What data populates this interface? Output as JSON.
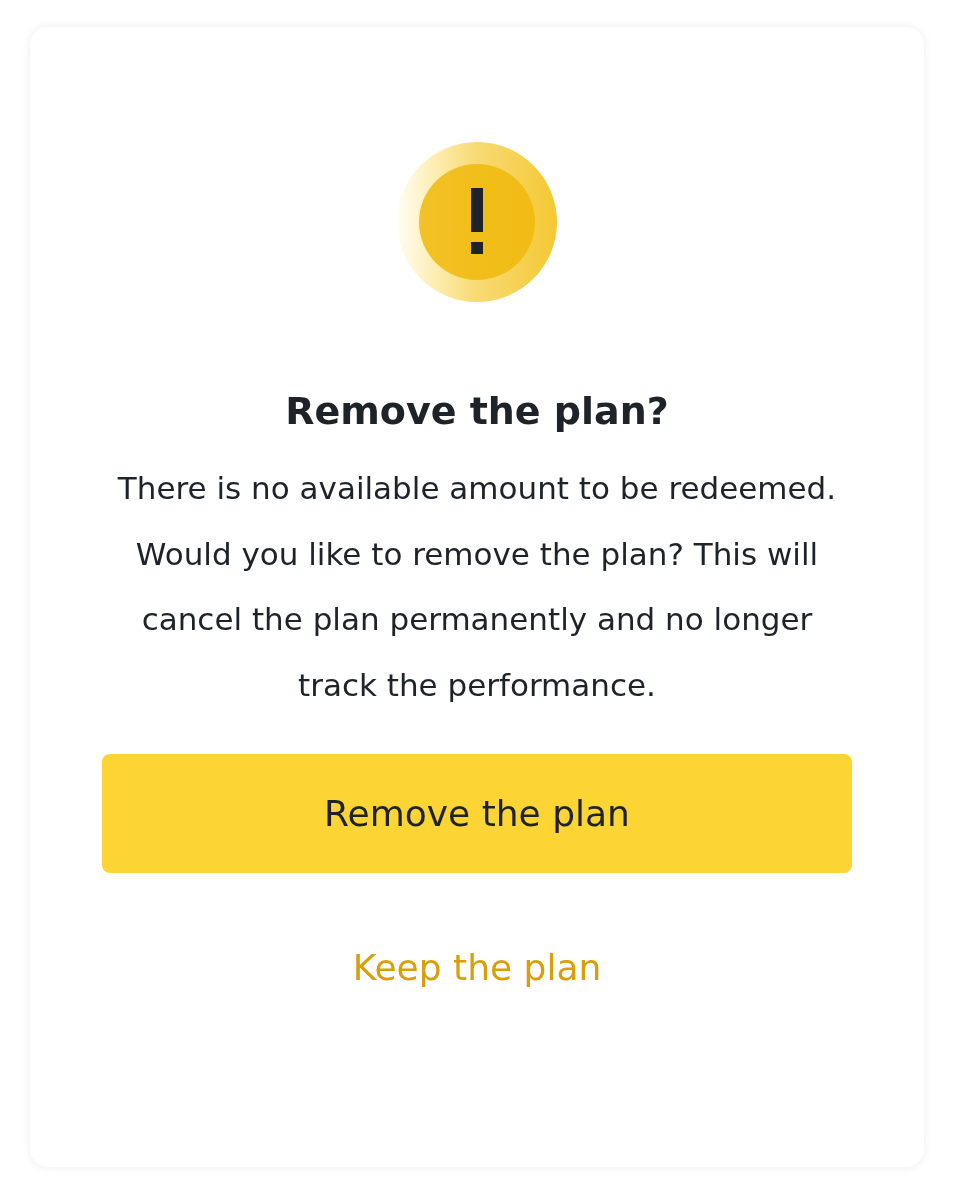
{
  "dialog": {
    "title": "Remove the plan?",
    "message": "There is no available amount to be redeemed. Would you like to remove the plan? This will cancel the plan permanently and no longer track the performance.",
    "buttons": [
      {
        "label": "Remove the plan",
        "kind": "primary"
      },
      {
        "label": "Keep the plan",
        "kind": "link"
      }
    ]
  }
}
